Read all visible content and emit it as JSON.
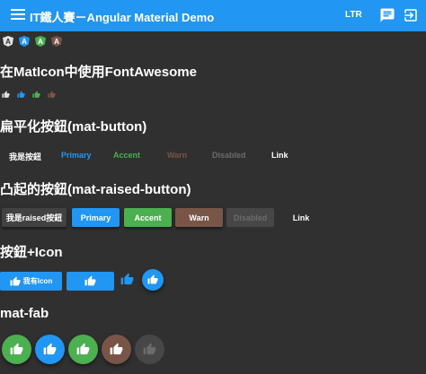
{
  "toolbar": {
    "title": "IT鐵人賽－Angular Material Demo",
    "ltr_label": "LTR",
    "menu_icon": "menu-icon",
    "chat_icon": "chat-icon",
    "exit_icon": "exit-to-app-icon"
  },
  "logos": [
    "A",
    "A",
    "A",
    "A"
  ],
  "sections": {
    "fonticon": "在MatIcon中使用FontAwesome",
    "flat": "扁平化按鈕(mat-button)",
    "raised": "凸起的按鈕(mat-raised-button)",
    "icon_buttons": "按鈕+Icon",
    "fab": "mat-fab"
  },
  "flat_buttons": {
    "basic": "我是按鈕",
    "primary": "Primary",
    "accent": "Accent",
    "warn": "Warn",
    "disabled": "Disabled",
    "link": "Link"
  },
  "raised_buttons": {
    "basic": "我是raised按鈕",
    "primary": "Primary",
    "accent": "Accent",
    "warn": "Warn",
    "disabled": "Disabled",
    "link": "Link"
  },
  "icon_buttons": {
    "with_text": "我有Icon"
  },
  "colors": {
    "primary": "#2196f3",
    "accent": "#4caf50",
    "warn": "#795548",
    "background": "#303030"
  }
}
